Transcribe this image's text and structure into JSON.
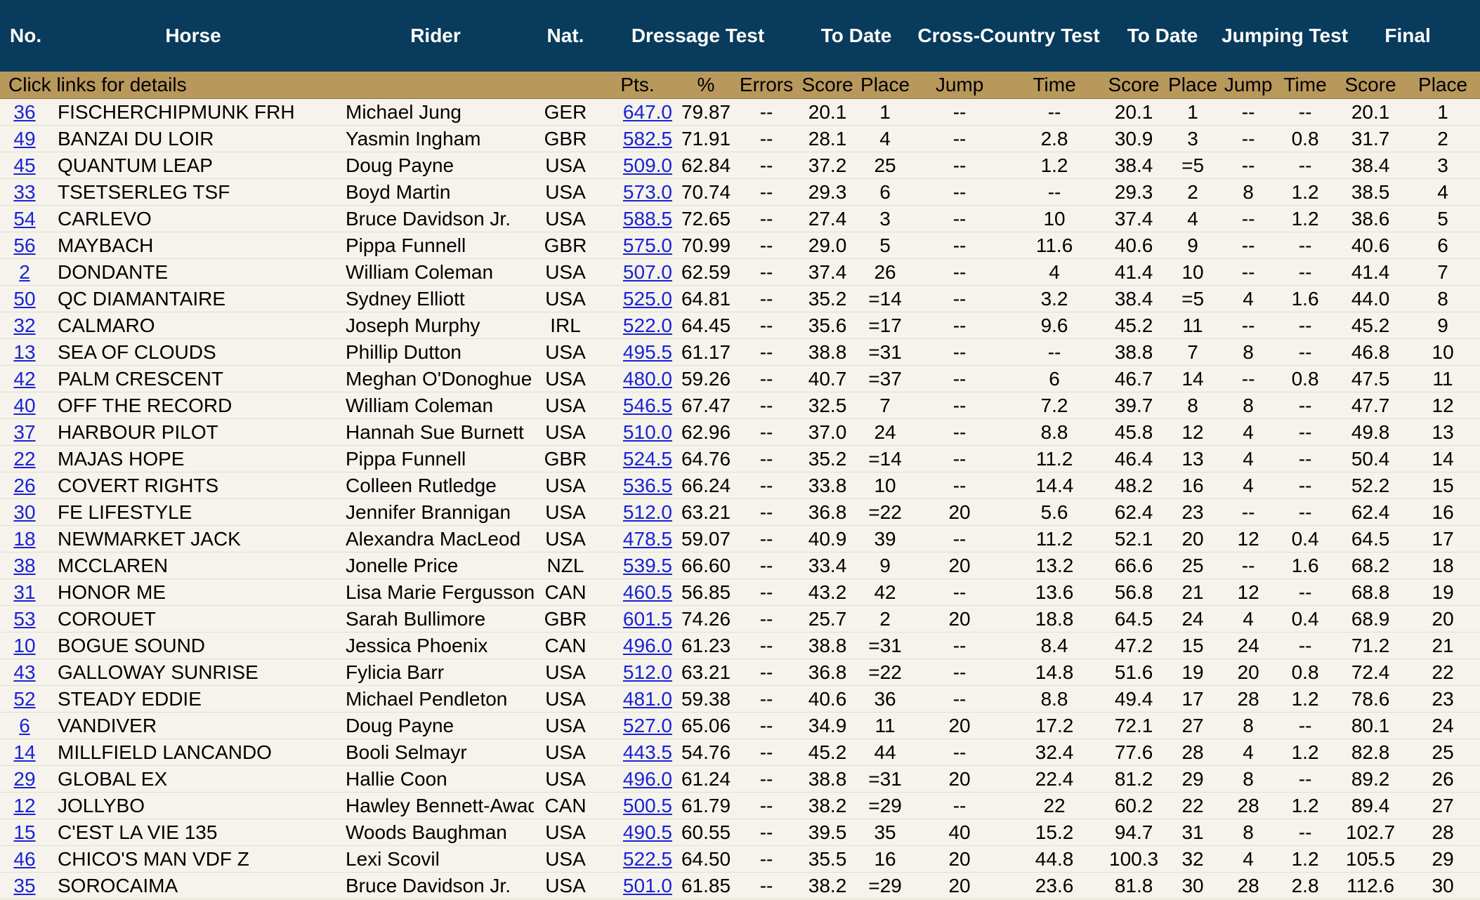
{
  "header": {
    "no": "No.",
    "horse": "Horse",
    "rider": "Rider",
    "nat": "Nat.",
    "dressage_test": "Dressage Test",
    "to_date_1": "To Date",
    "cross_country_test": "Cross-Country Test",
    "to_date_2": "To Date",
    "jumping_test": "Jumping Test",
    "final": "Final"
  },
  "subheader": {
    "note": "Click links for details",
    "pts": "Pts.",
    "pct": "%",
    "errors": "Errors",
    "score1": "Score",
    "place1": "Place",
    "jump1": "Jump",
    "time1": "Time",
    "score2": "Score",
    "place2": "Place",
    "jump2": "Jump",
    "time2": "Time",
    "score3": "Score",
    "place3": "Place"
  },
  "rows": [
    [
      "36",
      "FISCHERCHIPMUNK FRH",
      "Michael Jung",
      "GER",
      "647.0",
      "79.87",
      "--",
      "20.1",
      "1",
      "--",
      "--",
      "20.1",
      "1",
      "--",
      "--",
      "20.1",
      "1"
    ],
    [
      "49",
      "BANZAI DU LOIR",
      "Yasmin Ingham",
      "GBR",
      "582.5",
      "71.91",
      "--",
      "28.1",
      "4",
      "--",
      "2.8",
      "30.9",
      "3",
      "--",
      "0.8",
      "31.7",
      "2"
    ],
    [
      "45",
      "QUANTUM LEAP",
      "Doug Payne",
      "USA",
      "509.0",
      "62.84",
      "--",
      "37.2",
      "25",
      "--",
      "1.2",
      "38.4",
      "=5",
      "--",
      "--",
      "38.4",
      "3"
    ],
    [
      "33",
      "TSETSERLEG TSF",
      "Boyd Martin",
      "USA",
      "573.0",
      "70.74",
      "--",
      "29.3",
      "6",
      "--",
      "--",
      "29.3",
      "2",
      "8",
      "1.2",
      "38.5",
      "4"
    ],
    [
      "54",
      "CARLEVO",
      "Bruce Davidson Jr.",
      "USA",
      "588.5",
      "72.65",
      "--",
      "27.4",
      "3",
      "--",
      "10",
      "37.4",
      "4",
      "--",
      "1.2",
      "38.6",
      "5"
    ],
    [
      "56",
      "MAYBACH",
      "Pippa Funnell",
      "GBR",
      "575.0",
      "70.99",
      "--",
      "29.0",
      "5",
      "--",
      "11.6",
      "40.6",
      "9",
      "--",
      "--",
      "40.6",
      "6"
    ],
    [
      "2",
      "DONDANTE",
      "William Coleman",
      "USA",
      "507.0",
      "62.59",
      "--",
      "37.4",
      "26",
      "--",
      "4",
      "41.4",
      "10",
      "--",
      "--",
      "41.4",
      "7"
    ],
    [
      "50",
      "QC DIAMANTAIRE",
      "Sydney Elliott",
      "USA",
      "525.0",
      "64.81",
      "--",
      "35.2",
      "=14",
      "--",
      "3.2",
      "38.4",
      "=5",
      "4",
      "1.6",
      "44.0",
      "8"
    ],
    [
      "32",
      "CALMARO",
      "Joseph Murphy",
      "IRL",
      "522.0",
      "64.45",
      "--",
      "35.6",
      "=17",
      "--",
      "9.6",
      "45.2",
      "11",
      "--",
      "--",
      "45.2",
      "9"
    ],
    [
      "13",
      "SEA OF CLOUDS",
      "Phillip Dutton",
      "USA",
      "495.5",
      "61.17",
      "--",
      "38.8",
      "=31",
      "--",
      "--",
      "38.8",
      "7",
      "8",
      "--",
      "46.8",
      "10"
    ],
    [
      "42",
      "PALM CRESCENT",
      "Meghan O'Donoghue",
      "USA",
      "480.0",
      "59.26",
      "--",
      "40.7",
      "=37",
      "--",
      "6",
      "46.7",
      "14",
      "--",
      "0.8",
      "47.5",
      "11"
    ],
    [
      "40",
      "OFF THE RECORD",
      "William Coleman",
      "USA",
      "546.5",
      "67.47",
      "--",
      "32.5",
      "7",
      "--",
      "7.2",
      "39.7",
      "8",
      "8",
      "--",
      "47.7",
      "12"
    ],
    [
      "37",
      "HARBOUR PILOT",
      "Hannah Sue Burnett",
      "USA",
      "510.0",
      "62.96",
      "--",
      "37.0",
      "24",
      "--",
      "8.8",
      "45.8",
      "12",
      "4",
      "--",
      "49.8",
      "13"
    ],
    [
      "22",
      "MAJAS HOPE",
      "Pippa Funnell",
      "GBR",
      "524.5",
      "64.76",
      "--",
      "35.2",
      "=14",
      "--",
      "11.2",
      "46.4",
      "13",
      "4",
      "--",
      "50.4",
      "14"
    ],
    [
      "26",
      "COVERT RIGHTS",
      "Colleen Rutledge",
      "USA",
      "536.5",
      "66.24",
      "--",
      "33.8",
      "10",
      "--",
      "14.4",
      "48.2",
      "16",
      "4",
      "--",
      "52.2",
      "15"
    ],
    [
      "30",
      "FE LIFESTYLE",
      "Jennifer Brannigan",
      "USA",
      "512.0",
      "63.21",
      "--",
      "36.8",
      "=22",
      "20",
      "5.6",
      "62.4",
      "23",
      "--",
      "--",
      "62.4",
      "16"
    ],
    [
      "18",
      "NEWMARKET JACK",
      "Alexandra MacLeod",
      "USA",
      "478.5",
      "59.07",
      "--",
      "40.9",
      "39",
      "--",
      "11.2",
      "52.1",
      "20",
      "12",
      "0.4",
      "64.5",
      "17"
    ],
    [
      "38",
      "MCCLAREN",
      "Jonelle Price",
      "NZL",
      "539.5",
      "66.60",
      "--",
      "33.4",
      "9",
      "20",
      "13.2",
      "66.6",
      "25",
      "--",
      "1.6",
      "68.2",
      "18"
    ],
    [
      "31",
      "HONOR ME",
      "Lisa Marie Fergusson",
      "CAN",
      "460.5",
      "56.85",
      "--",
      "43.2",
      "42",
      "--",
      "13.6",
      "56.8",
      "21",
      "12",
      "--",
      "68.8",
      "19"
    ],
    [
      "53",
      "COROUET",
      "Sarah Bullimore",
      "GBR",
      "601.5",
      "74.26",
      "--",
      "25.7",
      "2",
      "20",
      "18.8",
      "64.5",
      "24",
      "4",
      "0.4",
      "68.9",
      "20"
    ],
    [
      "10",
      "BOGUE SOUND",
      "Jessica Phoenix",
      "CAN",
      "496.0",
      "61.23",
      "--",
      "38.8",
      "=31",
      "--",
      "8.4",
      "47.2",
      "15",
      "24",
      "--",
      "71.2",
      "21"
    ],
    [
      "43",
      "GALLOWAY SUNRISE",
      "Fylicia Barr",
      "USA",
      "512.0",
      "63.21",
      "--",
      "36.8",
      "=22",
      "--",
      "14.8",
      "51.6",
      "19",
      "20",
      "0.8",
      "72.4",
      "22"
    ],
    [
      "52",
      "STEADY EDDIE",
      "Michael Pendleton",
      "USA",
      "481.0",
      "59.38",
      "--",
      "40.6",
      "36",
      "--",
      "8.8",
      "49.4",
      "17",
      "28",
      "1.2",
      "78.6",
      "23"
    ],
    [
      "6",
      "VANDIVER",
      "Doug Payne",
      "USA",
      "527.0",
      "65.06",
      "--",
      "34.9",
      "11",
      "20",
      "17.2",
      "72.1",
      "27",
      "8",
      "--",
      "80.1",
      "24"
    ],
    [
      "14",
      "MILLFIELD LANCANDO",
      "Booli Selmayr",
      "USA",
      "443.5",
      "54.76",
      "--",
      "45.2",
      "44",
      "--",
      "32.4",
      "77.6",
      "28",
      "4",
      "1.2",
      "82.8",
      "25"
    ],
    [
      "29",
      "GLOBAL EX",
      "Hallie Coon",
      "USA",
      "496.0",
      "61.24",
      "--",
      "38.8",
      "=31",
      "20",
      "22.4",
      "81.2",
      "29",
      "8",
      "--",
      "89.2",
      "26"
    ],
    [
      "12",
      "JOLLYBO",
      "Hawley Bennett-Awad",
      "CAN",
      "500.5",
      "61.79",
      "--",
      "38.2",
      "=29",
      "--",
      "22",
      "60.2",
      "22",
      "28",
      "1.2",
      "89.4",
      "27"
    ],
    [
      "15",
      "C'EST LA VIE 135",
      "Woods Baughman",
      "USA",
      "490.5",
      "60.55",
      "--",
      "39.5",
      "35",
      "40",
      "15.2",
      "94.7",
      "31",
      "8",
      "--",
      "102.7",
      "28"
    ],
    [
      "46",
      "CHICO'S MAN VDF Z",
      "Lexi Scovil",
      "USA",
      "522.5",
      "64.50",
      "--",
      "35.5",
      "16",
      "20",
      "44.8",
      "100.3",
      "32",
      "4",
      "1.2",
      "105.5",
      "29"
    ],
    [
      "35",
      "SOROCAIMA",
      "Bruce Davidson Jr.",
      "USA",
      "501.0",
      "61.85",
      "--",
      "38.2",
      "=29",
      "20",
      "23.6",
      "81.8",
      "30",
      "28",
      "2.8",
      "112.6",
      "30"
    ]
  ],
  "colors": {
    "header_bg": "#083b5c",
    "subheader_bg": "#b9985b",
    "row_bg": "#f5f3ec",
    "link": "#1a22d6"
  }
}
